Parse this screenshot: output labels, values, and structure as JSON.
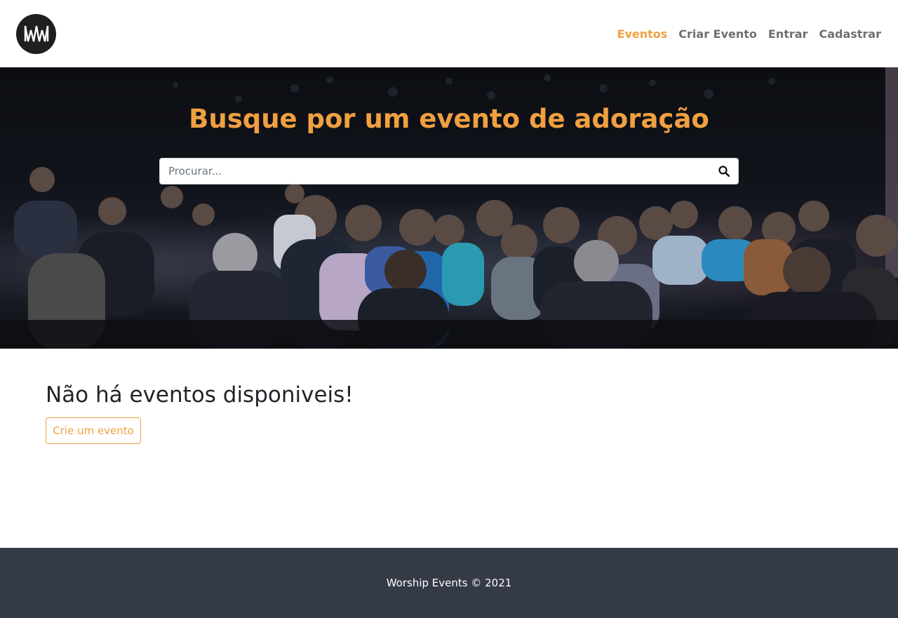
{
  "brand": {
    "logo_icon": "worship-events-logo",
    "logo_color": "#1f1f21"
  },
  "nav": {
    "items": [
      {
        "label": "Eventos",
        "active": true
      },
      {
        "label": "Criar Evento",
        "active": false
      },
      {
        "label": "Entrar",
        "active": false
      },
      {
        "label": "Cadastrar",
        "active": false
      }
    ]
  },
  "hero": {
    "title": "Busque por um evento de adoração",
    "search_placeholder": "Procurar...",
    "search_icon": "search-icon"
  },
  "main": {
    "empty_message": "Não há eventos disponiveis!",
    "create_button": "Crie um evento"
  },
  "footer": {
    "text": "Worship Events © 2021"
  },
  "colors": {
    "accent": "#f0a040",
    "nav_text": "#6c6f73",
    "footer_bg": "#343a46"
  }
}
